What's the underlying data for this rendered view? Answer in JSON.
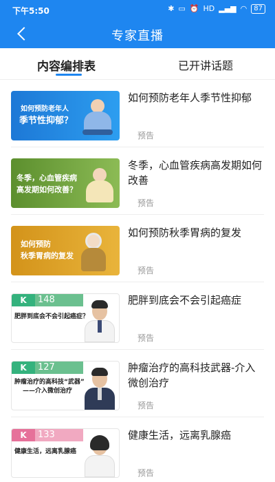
{
  "status_bar": {
    "time": "下午5:50",
    "icons": [
      "bluetooth-icon",
      "battery-saver-icon",
      "alarm-icon",
      "hd-icon",
      "signal-icon",
      "wifi-icon"
    ],
    "battery": "87"
  },
  "header": {
    "title": "专家直播"
  },
  "tabs": [
    {
      "label": "内容编排表",
      "active": true
    },
    {
      "label": "已开讲话题",
      "active": false
    }
  ],
  "colors": {
    "primary": "#1e86f0",
    "badge_text": "#999999"
  },
  "items": [
    {
      "title": "如何预防老年人季节性抑郁",
      "status": "预告",
      "thumb_caption_1": "如何预防老年人",
      "thumb_caption_2": "季节性抑郁？"
    },
    {
      "title": "冬季，心血管疾病高发期如何改善",
      "status": "预告",
      "thumb_caption_1": "冬季，心血管疾病",
      "thumb_caption_2": "高发期如何改善？"
    },
    {
      "title": "如何预防秋季胃病的复发",
      "status": "预告",
      "thumb_caption_1": "如何预防",
      "thumb_caption_2": "秋季胃病的复发"
    },
    {
      "title": "肥胖到底会不会引起癌症",
      "status": "预告",
      "thumb_num": "148",
      "thumb_caption_1": "肥胖到底会不会引起癌症？"
    },
    {
      "title": "肿瘤治疗的高科技武器-介入微创治疗",
      "status": "预告",
      "thumb_num": "127",
      "thumb_caption_1": "肿瘤治疗的高科技“武器”",
      "thumb_caption_2": "——介入微创治疗"
    },
    {
      "title": "健康生活，远离乳腺癌",
      "status": "预告",
      "thumb_num": "133",
      "thumb_caption_1": "健康生活，远离乳腺癌"
    }
  ]
}
